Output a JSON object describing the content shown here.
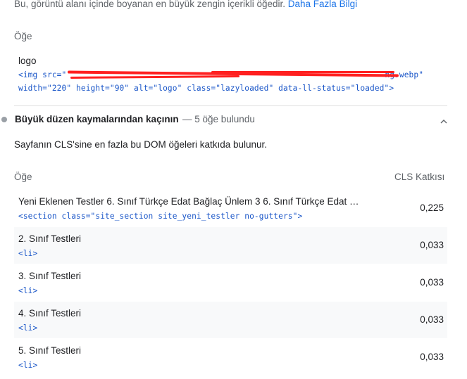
{
  "top_note": {
    "text": "Bu, görüntü alanı içinde boyanan en büyük zengin içerikli öğedir.",
    "link": "Daha Fazla Bilgi"
  },
  "lcp_table": {
    "header_element": "Öğe",
    "item": {
      "label": "logo",
      "code_line1_start": "<img src=\"",
      "code_line1_end": "ng.webp\"",
      "code_line2": "width=\"220\" height=\"90\" alt=\"logo\" class=\"lazyloaded\" data-ll-status=\"loaded\">"
    }
  },
  "cls_audit": {
    "title": "Büyük düzen kaymalarından kaçının",
    "summary": "— 5 öğe bulundu",
    "description": "Sayfanın CLS'sine en fazla bu DOM öğeleri katkıda bulunur.",
    "col_element": "Öğe",
    "col_cls": "CLS Katkısı",
    "rows": [
      {
        "label": "Yeni Eklenen Testler 6. Sınıf Türkçe Edat Bağlaç Ünlem 3 6. Sınıf Türkçe Edat …",
        "code": "<section class=\"site_section site_yeni_testler no-gutters\">",
        "value": "0,225"
      },
      {
        "label": "2. Sınıf Testleri",
        "code": "<li>",
        "value": "0,033"
      },
      {
        "label": "3. Sınıf Testleri",
        "code": "<li>",
        "value": "0,033"
      },
      {
        "label": "4. Sınıf Testleri",
        "code": "<li>",
        "value": "0,033"
      },
      {
        "label": "5. Sınıf Testleri",
        "code": "<li>",
        "value": "0,033"
      }
    ]
  }
}
